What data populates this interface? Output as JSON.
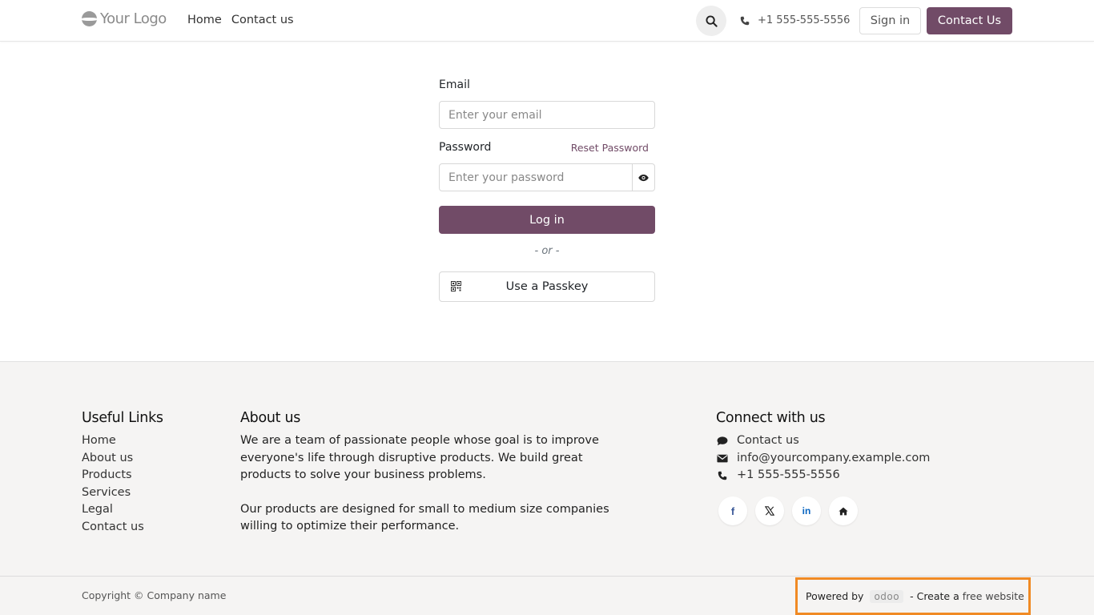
{
  "header": {
    "logo_text": "Your Logo",
    "nav": [
      "Home",
      "Contact us"
    ],
    "phone": "+1 555-555-5556",
    "signin_label": "Sign in",
    "contact_label": "Contact Us"
  },
  "login": {
    "email_label": "Email",
    "email_placeholder": "Enter your email",
    "password_label": "Password",
    "reset_label": "Reset Password",
    "password_placeholder": "Enter your password",
    "login_label": "Log in",
    "or_label": "- or -",
    "passkey_label": "Use a Passkey"
  },
  "footer": {
    "links_title": "Useful Links",
    "links": [
      "Home",
      "About us",
      "Products",
      "Services",
      "Legal",
      "Contact us"
    ],
    "about_title": "About us",
    "about_p1": "We are a team of passionate people whose goal is to improve everyone's life through disruptive products. We build great products to solve your business problems.",
    "about_p2": "Our products are designed for small to medium size companies willing to optimize their performance.",
    "connect_title": "Connect with us",
    "connect_items": [
      {
        "icon": "comment-icon",
        "text": "Contact us"
      },
      {
        "icon": "envelope-icon",
        "text": "info@yourcompany.example.com"
      },
      {
        "icon": "phone-icon",
        "text": "+1 555-555-5556"
      }
    ],
    "socials": [
      "facebook-icon",
      "x-icon",
      "linkedin-icon",
      "home-icon"
    ]
  },
  "bottom": {
    "copyright": "Copyright © Company name",
    "powered_by": "Powered by",
    "odoo": "odoo",
    "create_prefix": "- Create a",
    "create_link": "free website"
  },
  "colors": {
    "brand": "#714b67",
    "highlight": "#f08a24"
  }
}
